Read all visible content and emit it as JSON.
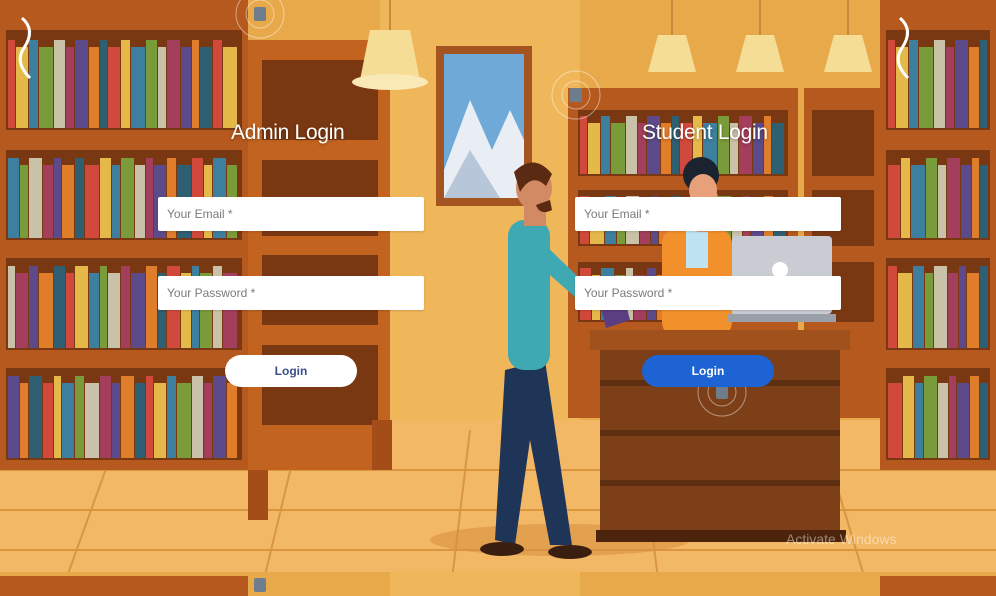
{
  "admin": {
    "title": "Admin Login",
    "email_placeholder": "Your Email *",
    "password_placeholder": "Your Password *",
    "login_label": "Login"
  },
  "student": {
    "title": "Student Login",
    "email_placeholder": "Your Email *",
    "password_placeholder": "Your Password *",
    "login_label": "Login"
  },
  "watermark": "Activate Windows",
  "colors": {
    "wall": "#e8a94a",
    "floor": "#f0b562",
    "shelf_wood": "#b5591e",
    "student_button": "#1d63d3",
    "admin_button": "#ffffff"
  }
}
